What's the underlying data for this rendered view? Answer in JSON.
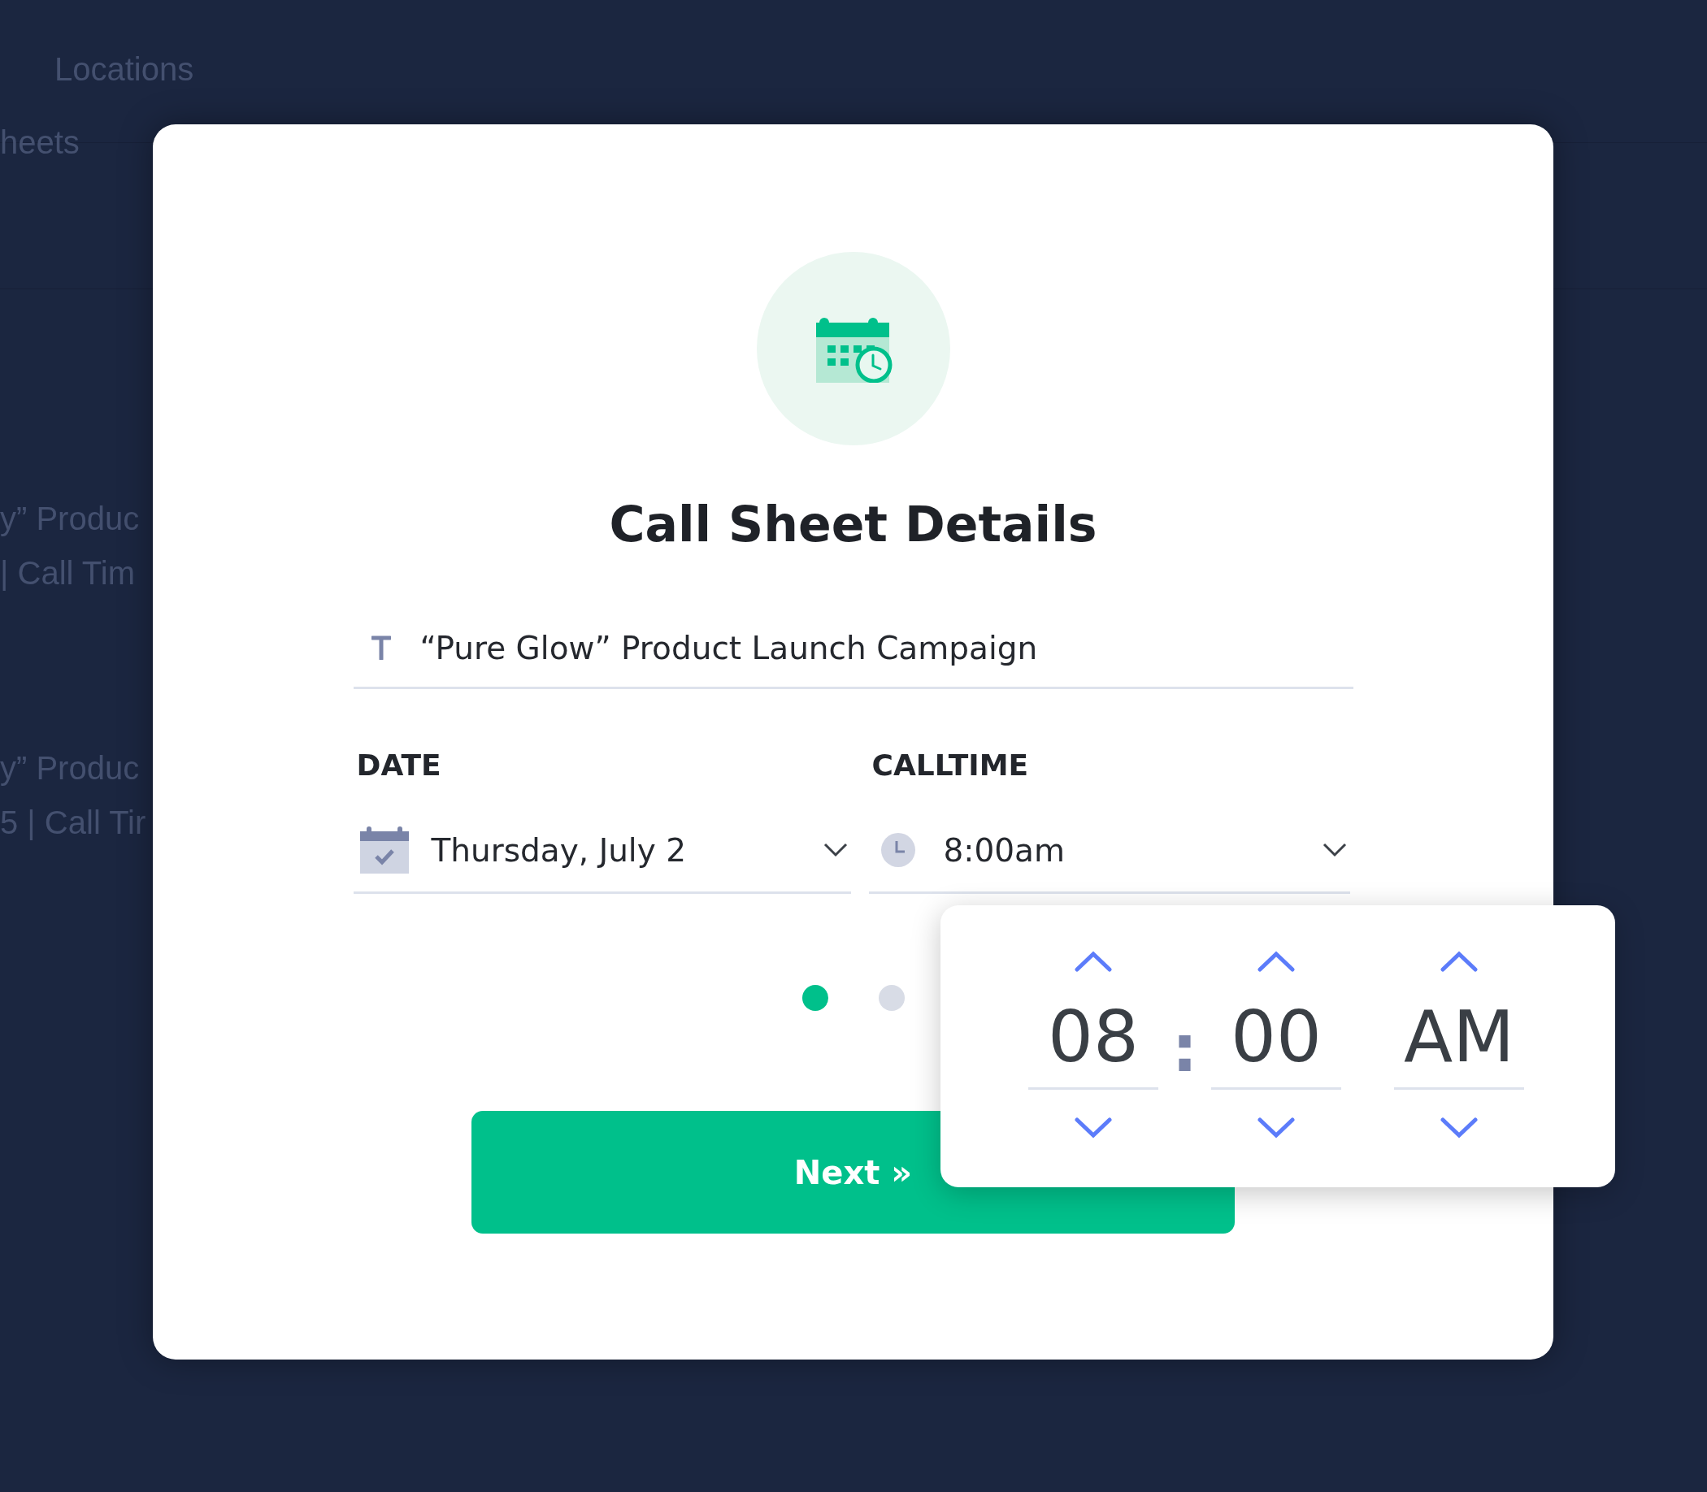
{
  "background": {
    "nav_item": "Locations",
    "tab": "heets",
    "rows": [
      {
        "title": "y” Produc",
        "subtitle": "| Call Tim"
      },
      {
        "title": "y” Produc",
        "subtitle": "5 | Call Tir"
      }
    ]
  },
  "dialog": {
    "title": "Call Sheet Details",
    "name_field": {
      "value": "“Pure Glow” Product Launch Campaign"
    },
    "fields": [
      {
        "kind": "date",
        "label": "DATE",
        "value": "Thursday, July 2"
      },
      {
        "kind": "time",
        "label": "CALLTIME",
        "value": "8:00am"
      }
    ],
    "steps": [
      {
        "selected": true
      },
      {
        "selected": false
      }
    ],
    "next_button": "Next »"
  },
  "time_picker": {
    "separator": ":",
    "columns": [
      {
        "kind": "hour",
        "value": "08"
      },
      {
        "kind": "minute",
        "value": "00"
      },
      {
        "kind": "period",
        "value": "AM"
      }
    ]
  }
}
